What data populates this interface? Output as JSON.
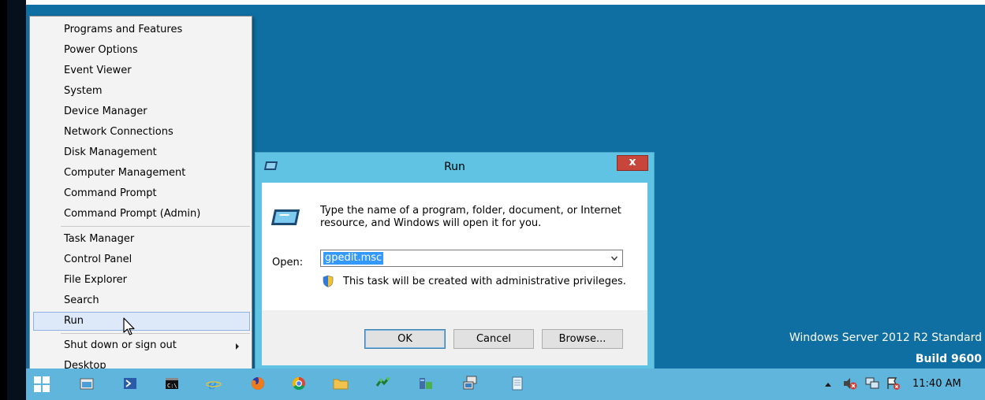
{
  "desktop": {
    "watermark_line1": "Windows Server 2012 R2 Standard",
    "watermark_line2": "Build 9600",
    "background_color": "#0f6fa2"
  },
  "winx_menu": {
    "items": [
      {
        "label": "Programs and Features"
      },
      {
        "label": "Power Options"
      },
      {
        "label": "Event Viewer"
      },
      {
        "label": "System"
      },
      {
        "label": "Device Manager"
      },
      {
        "label": "Network Connections"
      },
      {
        "label": "Disk Management"
      },
      {
        "label": "Computer Management"
      },
      {
        "label": "Command Prompt"
      },
      {
        "label": "Command Prompt (Admin)"
      },
      {
        "label": "Task Manager"
      },
      {
        "label": "Control Panel"
      },
      {
        "label": "File Explorer"
      },
      {
        "label": "Search"
      },
      {
        "label": "Run",
        "highlighted": true
      },
      {
        "label": "Shut down or sign out",
        "has_submenu": true
      },
      {
        "label": "Desktop"
      }
    ]
  },
  "run_dialog": {
    "title": "Run",
    "close_label": "x",
    "description": "Type the name of a program, folder, document, or Internet resource, and Windows will open it for you.",
    "open_label": "Open:",
    "open_value": "gpedit.msc",
    "admin_note": "This task will be created with administrative privileges.",
    "ok_label": "OK",
    "cancel_label": "Cancel",
    "browse_label": "Browse..."
  },
  "taskbar": {
    "pinned_icons": [
      "file-explorer-icon",
      "powershell-icon",
      "cmd-icon",
      "internet-explorer-icon",
      "firefox-icon",
      "chrome-icon",
      "folder-icon",
      "network-tool-icon",
      "server-manager-icon",
      "remote-desktop-icon",
      "notepad-icon"
    ],
    "tray_icons": [
      "volume-muted-icon",
      "network-icon",
      "action-center-icon"
    ],
    "clock": "11:40 AM",
    "color": "#5fb5dc"
  }
}
